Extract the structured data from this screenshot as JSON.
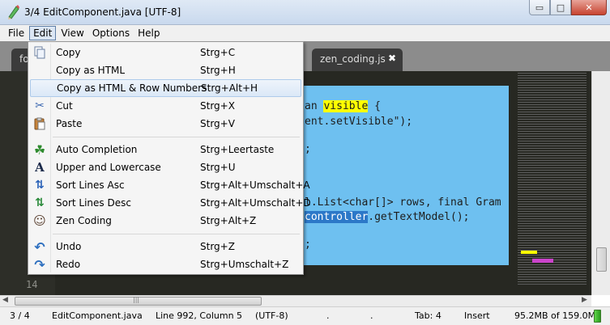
{
  "window": {
    "title": "3/4  EditComponent.java [UTF-8]",
    "controls": {
      "minimize": "▭",
      "maximize": "□",
      "close": "✕"
    }
  },
  "menubar": {
    "items": [
      "File",
      "Edit",
      "View",
      "Options",
      "Help"
    ],
    "active": "Edit"
  },
  "tabs": [
    {
      "label": "fo",
      "active": false
    },
    {
      "label": "zen_coding.js",
      "active": false,
      "close": "✖"
    }
  ],
  "editor": {
    "visible_line_number": "14",
    "code_lines": [
      {
        "before": "an ",
        "highlight": "visible",
        "after": " {"
      },
      {
        "before": "ent.setVisible\");",
        "highlight": "",
        "after": ""
      },
      {
        "before": ";",
        "highlight": "",
        "after": ""
      },
      {
        "before": "l.List<char[]> rows, final Gram",
        "highlight": "",
        "after": ""
      },
      {
        "before": "",
        "highlight_blue": "controller",
        "after": ".getTextModel();"
      },
      {
        "before": ";",
        "highlight": "",
        "after": ""
      }
    ],
    "colors": {
      "background": "#272822",
      "selection": "#6ec0f0",
      "match": "#ffff00"
    }
  },
  "edit_menu": {
    "groups": [
      [
        {
          "icon": "copy-icon",
          "glyph": "📄",
          "label": "Copy",
          "accel": "Strg+C"
        },
        {
          "icon": "copy-html-icon",
          "glyph": "",
          "label": "Copy as HTML",
          "accel": "Strg+H"
        },
        {
          "icon": "copy-html-rows-icon",
          "glyph": "",
          "label": "Copy as HTML & Row Numbers",
          "accel": "Strg+Alt+H",
          "hover": true
        },
        {
          "icon": "scissors-icon",
          "glyph": "✂",
          "label": "Cut",
          "accel": "Strg+X"
        },
        {
          "icon": "paste-icon",
          "glyph": "📋",
          "label": "Paste",
          "accel": "Strg+V"
        }
      ],
      [
        {
          "icon": "clover-icon",
          "glyph": "☘",
          "label": "Auto Completion",
          "accel": "Strg+Leertaste"
        },
        {
          "icon": "font-case-icon",
          "glyph": "A",
          "label": "Upper and Lowercase",
          "accel": "Strg+U"
        },
        {
          "icon": "sort-asc-icon",
          "glyph": "⇅",
          "label": "Sort Lines Asc",
          "accel": "Strg+Alt+Umschalt+A"
        },
        {
          "icon": "sort-desc-icon",
          "glyph": "⇅",
          "label": "Sort Lines Desc",
          "accel": "Strg+Alt+Umschalt+D"
        },
        {
          "icon": "zen-coding-icon",
          "glyph": "☺",
          "label": "Zen Coding",
          "accel": "Strg+Alt+Z"
        }
      ],
      [
        {
          "icon": "undo-icon",
          "glyph": "↶",
          "label": "Undo",
          "accel": "Strg+Z"
        },
        {
          "icon": "redo-icon",
          "glyph": "↷",
          "label": "Redo",
          "accel": "Strg+Umschalt+Z"
        }
      ]
    ]
  },
  "statusbar": {
    "page": "3 / 4",
    "file": "EditComponent.java",
    "position": "Line 992, Column 5",
    "encoding": "(UTF-8)",
    "dot1": ".",
    "dot2": ".",
    "tab": "Tab: 4",
    "mode": "Insert",
    "memory": "95.2MB of 159.0M"
  },
  "scroll": {
    "hscroll_arrow_left": "◀",
    "hscroll_arrow_right": "▶",
    "hthumb_grip": "|||"
  }
}
